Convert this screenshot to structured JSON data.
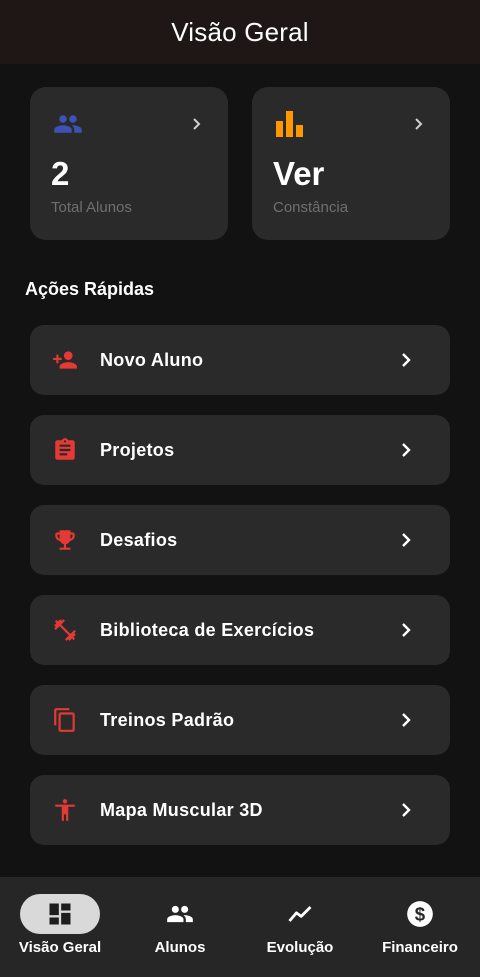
{
  "appbar": {
    "title": "Visão Geral"
  },
  "stats": [
    {
      "value": "2",
      "label": "Total Alunos",
      "icon": "people-icon",
      "color": "#3f51b5"
    },
    {
      "value": "Ver",
      "label": "Constância",
      "icon": "bar-chart-icon",
      "color": "#ff9800"
    }
  ],
  "section": {
    "title": "Ações Rápidas"
  },
  "actions": [
    {
      "label": "Novo Aluno",
      "icon": "person-add-icon"
    },
    {
      "label": "Projetos",
      "icon": "clipboard-icon"
    },
    {
      "label": "Desafios",
      "icon": "trophy-icon"
    },
    {
      "label": "Biblioteca de Exercícios",
      "icon": "dumbbell-icon"
    },
    {
      "label": "Treinos Padrão",
      "icon": "copy-icon"
    },
    {
      "label": "Mapa Muscular 3D",
      "icon": "body-icon"
    }
  ],
  "accent_color": "#e53935",
  "nav": {
    "active_index": 0,
    "items": [
      {
        "label": "Visão Geral",
        "icon": "dashboard-icon"
      },
      {
        "label": "Alunos",
        "icon": "people-icon"
      },
      {
        "label": "Evolução",
        "icon": "trending-up-icon"
      },
      {
        "label": "Financeiro",
        "icon": "dollar-icon"
      }
    ]
  }
}
